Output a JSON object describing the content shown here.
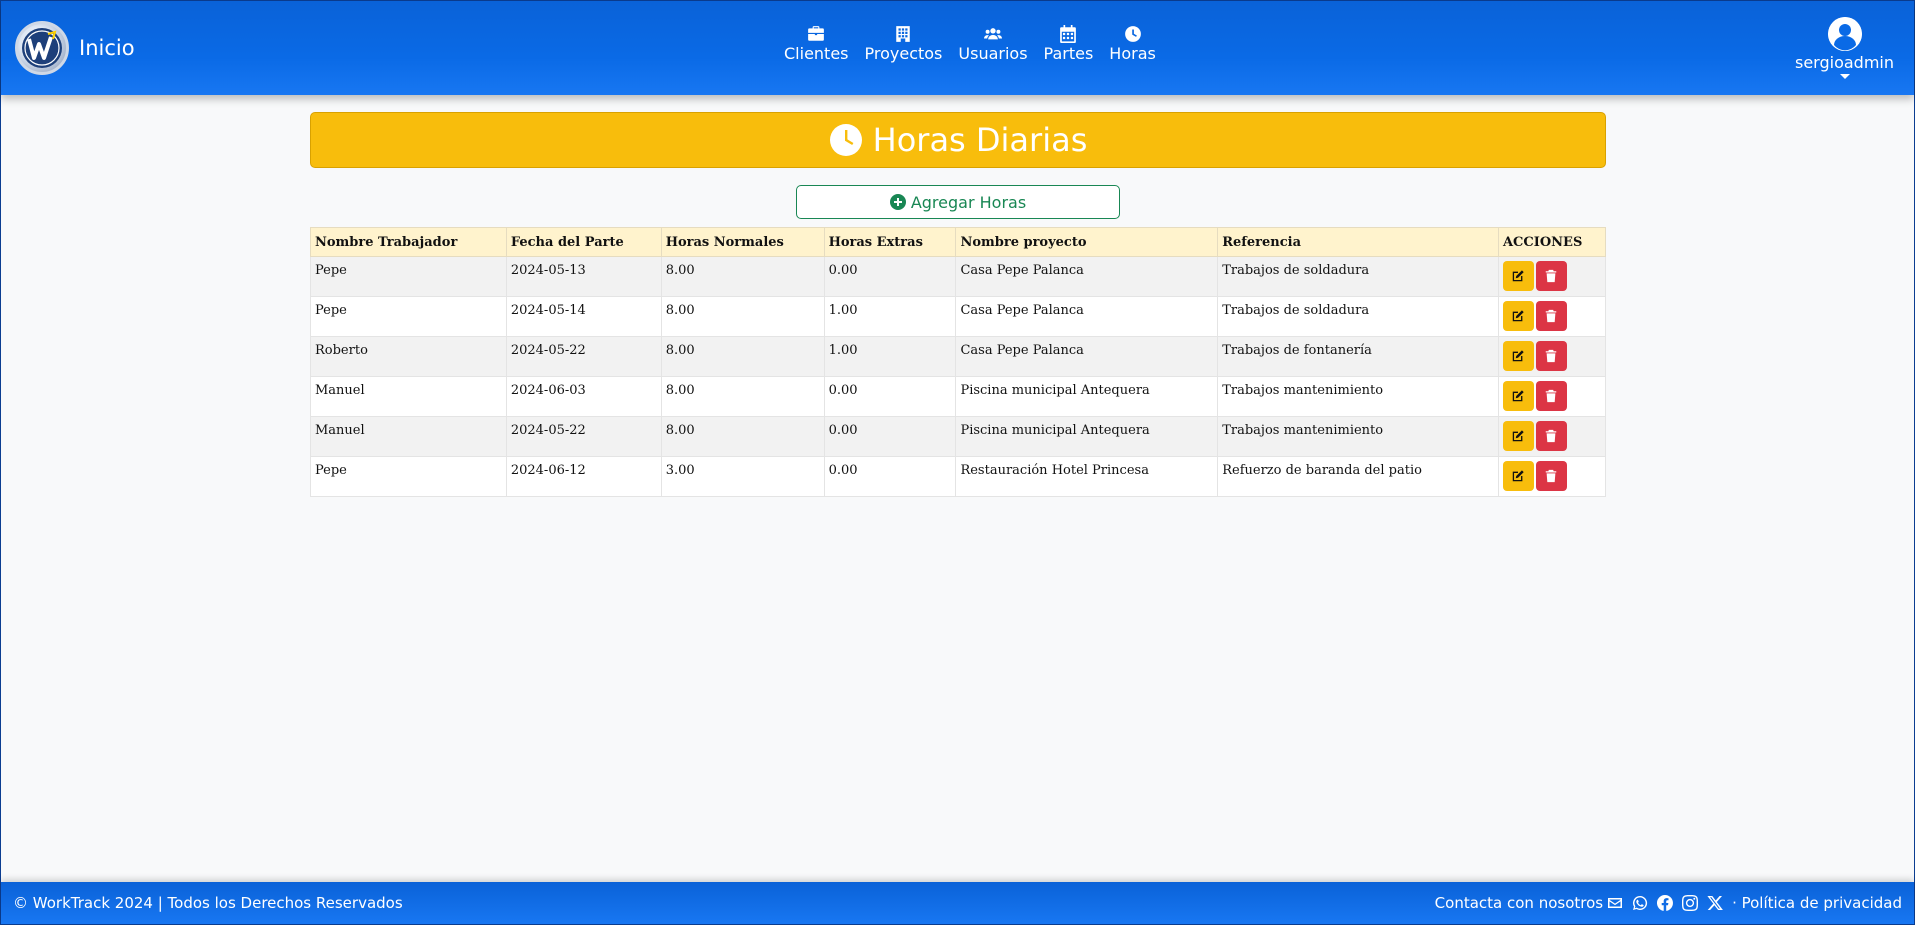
{
  "header": {
    "brand_label": "Inicio",
    "nav": [
      {
        "label": "Clientes",
        "icon": "briefcase-icon"
      },
      {
        "label": "Proyectos",
        "icon": "building-icon"
      },
      {
        "label": "Usuarios",
        "icon": "users-icon"
      },
      {
        "label": "Partes",
        "icon": "calendar-icon"
      },
      {
        "label": "Horas",
        "icon": "clock-icon"
      }
    ],
    "user": {
      "name": "sergioadmin",
      "icon": "user-circle-icon"
    }
  },
  "main": {
    "title": "Horas Diarias",
    "add_button_label": "Agregar Horas",
    "table": {
      "columns": [
        "Nombre Trabajador",
        "Fecha del Parte",
        "Horas Normales",
        "Horas Extras",
        "Nombre proyecto",
        "Referencia",
        "ACCIONES"
      ],
      "rows": [
        [
          "Pepe",
          "2024-05-13",
          "8.00",
          "0.00",
          "Casa Pepe Palanca",
          "Trabajos de soldadura"
        ],
        [
          "Pepe",
          "2024-05-14",
          "8.00",
          "1.00",
          "Casa Pepe Palanca",
          "Trabajos de soldadura"
        ],
        [
          "Roberto",
          "2024-05-22",
          "8.00",
          "1.00",
          "Casa Pepe Palanca",
          "Trabajos de fontanería"
        ],
        [
          "Manuel",
          "2024-06-03",
          "8.00",
          "0.00",
          "Piscina municipal Antequera",
          "Trabajos mantenimiento"
        ],
        [
          "Manuel",
          "2024-05-22",
          "8.00",
          "0.00",
          "Piscina municipal Antequera",
          "Trabajos mantenimiento"
        ],
        [
          "Pepe",
          "2024-06-12",
          "3.00",
          "0.00",
          "Restauración Hotel Princesa",
          "Refuerzo de baranda del patio"
        ]
      ]
    }
  },
  "footer": {
    "copyright": "© WorkTrack 2024 | Todos los Derechos Reservados",
    "contact_label": "Contacta con nosotros",
    "privacy_label": "· Política de privacidad"
  },
  "colors": {
    "navbar": "#0a6ae6",
    "title_banner": "#f8bd0c",
    "add_button": "#198754",
    "edit_button": "#f8bd0c",
    "delete_button": "#dc3545",
    "table_header": "#fff3cd"
  }
}
